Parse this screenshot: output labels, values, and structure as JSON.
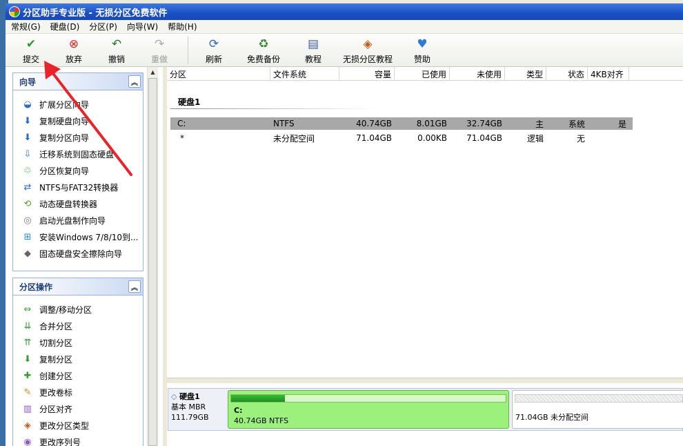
{
  "window": {
    "title": "分区助手专业版 - 无损分区免费软件"
  },
  "menu": [
    "常规(G)",
    "硬盘(D)",
    "分区(P)",
    "向导(W)",
    "帮助(H)"
  ],
  "toolbar": {
    "commit": "提交",
    "discard": "放弃",
    "undo": "撤销",
    "redo": "重做",
    "refresh": "刷新",
    "backup": "免费备份",
    "tutorial": "教程",
    "lossless_tutorial": "无损分区教程",
    "sponsor": "赞助"
  },
  "wizard_panel": {
    "title": "向导",
    "items": [
      "扩展分区向导",
      "复制硬盘向导",
      "复制分区向导",
      "迁移系统到固态硬盘",
      "分区恢复向导",
      "NTFS与FAT32转换器",
      "动态硬盘转换器",
      "启动光盘制作向导",
      "安装Windows 7/8/10到...",
      "固态硬盘安全擦除向导"
    ]
  },
  "partition_panel": {
    "title": "分区操作",
    "items": [
      "调整/移动分区",
      "合并分区",
      "切割分区",
      "复制分区",
      "创建分区",
      "更改卷标",
      "分区对齐",
      "更改分区类型",
      "更改序列号"
    ]
  },
  "table": {
    "columns": [
      "分区",
      "文件系统",
      "容量",
      "已使用",
      "未使用",
      "类型",
      "状态",
      "4KB对齐"
    ],
    "disk_label": "硬盘1",
    "rows": [
      {
        "partition": "C:",
        "fs": "NTFS",
        "capacity": "40.74GB",
        "used": "8.01GB",
        "free": "32.74GB",
        "type": "主",
        "status": "系统",
        "aligned": "是"
      },
      {
        "partition": "*",
        "fs": "未分配空间",
        "capacity": "71.04GB",
        "used": "0.00KB",
        "free": "71.04GB",
        "type": "逻辑",
        "status": "无",
        "aligned": ""
      }
    ]
  },
  "disk_map": {
    "name": "硬盘1",
    "kind": "基本 MBR",
    "size": "111.79GB",
    "c_label": "C:",
    "c_desc": "40.74GB NTFS",
    "c_used_fraction": 0.197,
    "unalloc_desc": "71.04GB 未分配空间"
  },
  "colors": {
    "selected_row": "#a8a8a8",
    "partition_green": "#9cf07c",
    "arrow": "#e8242a"
  }
}
